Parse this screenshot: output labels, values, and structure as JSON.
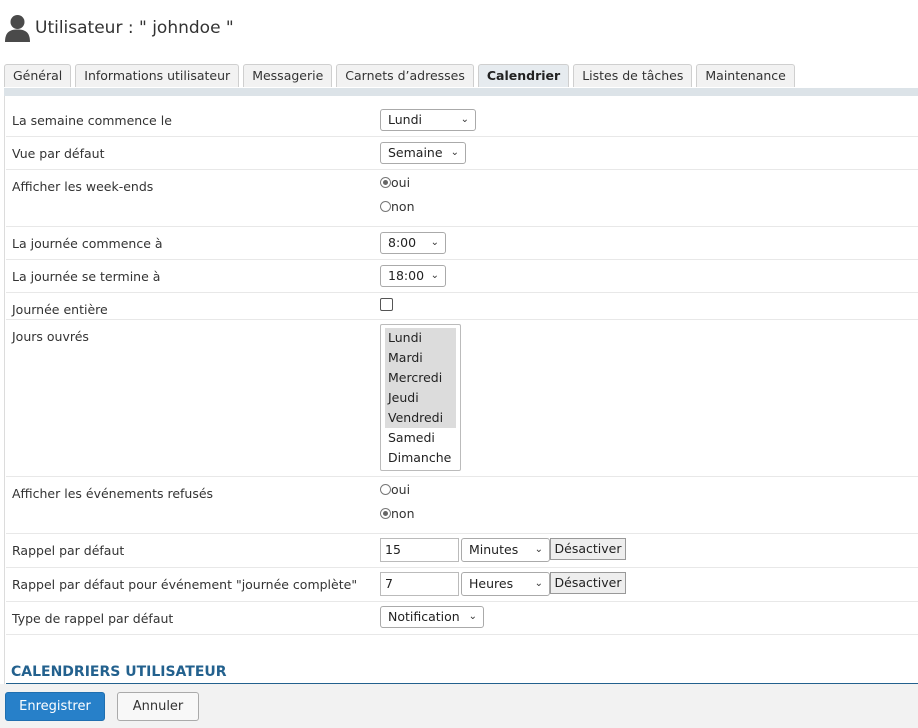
{
  "header": {
    "icon": "user-icon",
    "title": "Utilisateur : \" johndoe \""
  },
  "tabs": [
    {
      "label": "Général",
      "active": false
    },
    {
      "label": "Informations utilisateur",
      "active": false
    },
    {
      "label": "Messagerie",
      "active": false
    },
    {
      "label": "Carnets d’adresses",
      "active": false
    },
    {
      "label": "Calendrier",
      "active": true
    },
    {
      "label": "Listes de tâches",
      "active": false
    },
    {
      "label": "Maintenance",
      "active": false
    }
  ],
  "form": {
    "week_start": {
      "label": "La semaine commence le",
      "value": "Lundi"
    },
    "default_view": {
      "label": "Vue par défaut",
      "value": "Semaine"
    },
    "show_weekends": {
      "label": "Afficher les week-ends",
      "yes": "oui",
      "no": "non",
      "selected": "oui"
    },
    "day_start": {
      "label": "La journée commence à",
      "value": "8:00"
    },
    "day_end": {
      "label": "La journée se termine à",
      "value": "18:00"
    },
    "all_day": {
      "label": "Journée entière",
      "checked": false
    },
    "working_days": {
      "label": "Jours ouvrés",
      "options": [
        {
          "label": "Lundi",
          "selected": true
        },
        {
          "label": "Mardi",
          "selected": true
        },
        {
          "label": "Mercredi",
          "selected": true
        },
        {
          "label": "Jeudi",
          "selected": true
        },
        {
          "label": "Vendredi",
          "selected": true
        },
        {
          "label": "Samedi",
          "selected": false
        },
        {
          "label": "Dimanche",
          "selected": false
        }
      ]
    },
    "show_declined": {
      "label": "Afficher les événements refusés",
      "yes": "oui",
      "no": "non",
      "selected": "non"
    },
    "default_reminder": {
      "label": "Rappel par défaut",
      "value": "15",
      "unit": "Minutes",
      "disable_label": "Désactiver"
    },
    "allday_reminder": {
      "label": "Rappel par défaut pour événement \"journée complète\"",
      "value": "7",
      "unit": "Heures",
      "disable_label": "Désactiver"
    },
    "reminder_type": {
      "label": "Type de rappel par défaut",
      "value": "Notification"
    }
  },
  "section": {
    "title": "CALENDRIERS UTILISATEUR"
  },
  "footer": {
    "save_label": "Enregistrer",
    "cancel_label": "Annuler"
  },
  "colors": {
    "accent": "#2780c9",
    "section": "#23618e"
  }
}
